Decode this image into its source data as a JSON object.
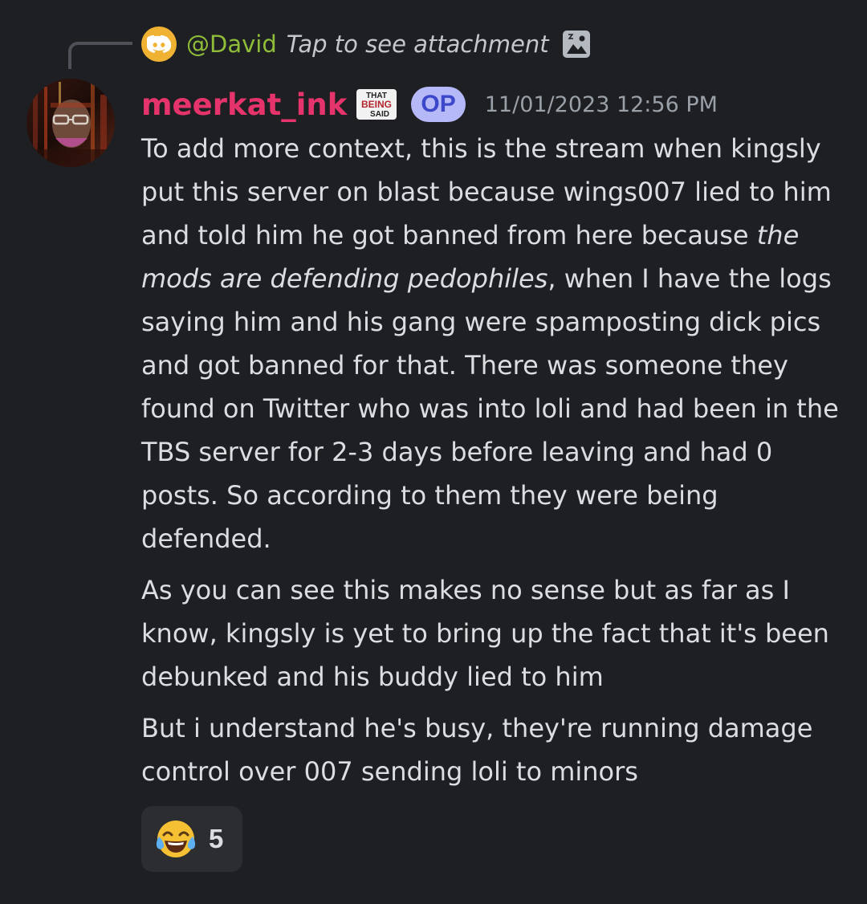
{
  "reply": {
    "author": "@David",
    "text": "Tap to see attachment",
    "discord_icon": "discord-icon",
    "attachment_icon": "image-icon"
  },
  "message": {
    "username": "meerkat_ink",
    "role_icon_text": [
      "THAT",
      "BEING",
      "SAID"
    ],
    "op_badge": "OP",
    "timestamp": "11/01/2023 12:56 PM",
    "paragraph1_part1": "To add more context, this is the stream when kingsly put this server on blast because wings007 lied to him and told him he got banned from here because ",
    "paragraph1_italic": "the mods are defending pedophiles",
    "paragraph1_part2": ", when I have the logs saying him and his gang were spamposting dick pics and got banned for that. There was someone they found on Twitter who was into loli and had been in the TBS server for 2-3 days before leaving and had 0 posts. So according to them they were being defended.",
    "paragraph2": "As you can see this makes no sense but as far as I know, kingsly is yet to bring up the fact that it's been debunked and his buddy lied to him",
    "paragraph3": "But i understand he's busy, they're running damage control over 007 sending loli to minors"
  },
  "reaction": {
    "emoji": "face-with-tears-of-joy",
    "count": "5"
  },
  "colors": {
    "background": "#1e1f22",
    "username": "#e5336b",
    "reply_author": "#8fbd3a",
    "op_badge_bg": "#b5b9f7",
    "op_badge_text": "#3d47c9",
    "reaction_bg": "#2b2d31"
  }
}
